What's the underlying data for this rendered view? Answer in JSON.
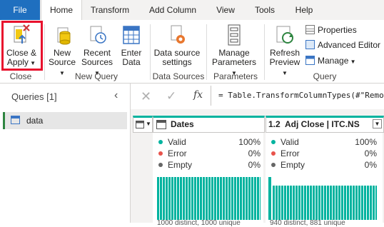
{
  "tabs": [
    "File",
    "Home",
    "Transform",
    "Add Column",
    "View",
    "Tools",
    "Help"
  ],
  "ribbon": {
    "close_apply": [
      "Close &",
      "Apply"
    ],
    "new_source": [
      "New",
      "Source"
    ],
    "recent_sources": [
      "Recent",
      "Sources"
    ],
    "enter_data": [
      "Enter",
      "Data"
    ],
    "data_source_settings": [
      "Data source",
      "settings"
    ],
    "manage_parameters": [
      "Manage",
      "Parameters"
    ],
    "refresh_preview": [
      "Refresh",
      "Preview"
    ],
    "properties": "Properties",
    "advanced_editor": "Advanced Editor",
    "manage": "Manage",
    "groups": {
      "close": "Close",
      "new_query": "New Query",
      "data_sources": "Data Sources",
      "parameters": "Parameters",
      "query": "Query"
    }
  },
  "queries_pane": {
    "title": "Queries [1]",
    "items": [
      "data"
    ]
  },
  "formula_bar": {
    "fx": "fx",
    "formula": "= Table.TransformColumnTypes(#\"Remo"
  },
  "columns": [
    {
      "type_icon": "table-type-icon",
      "name": ""
    },
    {
      "type_icon": "calendar-type-icon",
      "name": "Dates",
      "profile": {
        "valid": "Valid",
        "valid_pct": "100%",
        "error": "Error",
        "error_pct": "0%",
        "empty": "Empty",
        "empty_pct": "0%"
      },
      "footer": "1000 distinct, 1000 unique"
    },
    {
      "type_icon": "1.2",
      "name": "Adj Close | ITC.NS",
      "profile": {
        "valid": "Valid",
        "valid_pct": "100%",
        "error": "Error",
        "error_pct": "0%",
        "empty": "Empty",
        "empty_pct": "0%"
      },
      "footer": "940 distinct, 881 unique"
    }
  ],
  "colors": {
    "file_tab": "#1f6fbf",
    "valid": "#00b39f",
    "error": "#e8534b",
    "empty": "#666666",
    "highlight": "#e8112d"
  }
}
